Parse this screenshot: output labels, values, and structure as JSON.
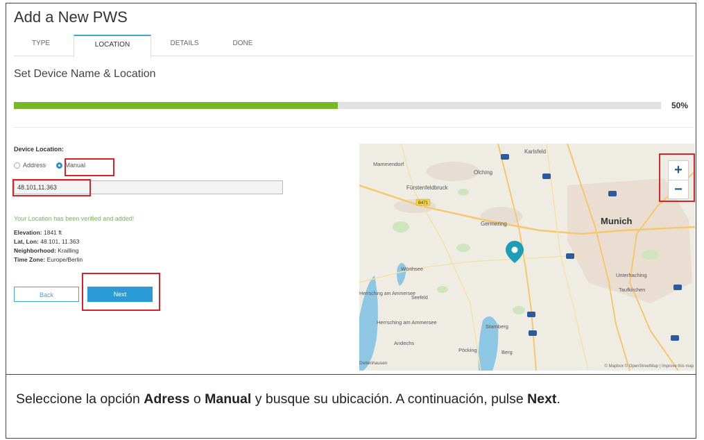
{
  "page": {
    "title": "Add a New PWS",
    "subtitle": "Set Device Name & Location"
  },
  "tabs": [
    {
      "label": "TYPE",
      "active": false
    },
    {
      "label": "LOCATION",
      "active": true
    },
    {
      "label": "DETAILS",
      "active": false
    },
    {
      "label": "DONE",
      "active": false
    }
  ],
  "progress": {
    "value": 0.5,
    "label": "50%"
  },
  "location": {
    "label": "Device Location:",
    "options": {
      "address": "Address",
      "manual": "Manual"
    },
    "selected": "Manual",
    "coordinates_value": "48.101,11.363",
    "verified_message": "Your Location has been verified and added!",
    "elevation": {
      "label": "Elevation:",
      "value": "1841 ft"
    },
    "latlon": {
      "label": "Lat, Lon:",
      "value": "48.101, 11.363"
    },
    "neighborhood": {
      "label": "Neighborhood:",
      "value": "Krailling"
    },
    "timezone": {
      "label": "Time Zone:",
      "value": "Europe/Berlin"
    }
  },
  "buttons": {
    "back": "Back",
    "next": "Next"
  },
  "map": {
    "places": {
      "karlsfeld": "Karlsfeld",
      "mammendorf": "Mammendorf",
      "olching": "Olching",
      "fuerstenfeldbruck": "Fürstenfeldbruck",
      "germering": "Germering",
      "munich": "Munich",
      "woerthsee": "Wörthsee",
      "unterhaching": "Unterhaching",
      "taufkirchen": "Taufkirchen",
      "herrsching1": "Herrsching am Ammersee",
      "seefeld": "Seefeld",
      "herrsching2": "Herrsching am Ammersee",
      "starnberg": "Starnberg",
      "andechs": "Andechs",
      "pocking": "Pöcking",
      "berg": "Berg",
      "dettenhausen": "Dettenhausen"
    },
    "road_badge": "B471",
    "zoom_in": "+",
    "zoom_out": "−",
    "attribution": "© Mapbox © OpenStreetMap | Improve this map"
  },
  "caption": {
    "part1": "Seleccione la opción ",
    "bold1": "Adress",
    "part2": " o ",
    "bold2": "Manual",
    "part3": " y busque su ubicación. A continuación, pulse ",
    "bold3": "Next",
    "part4": "."
  },
  "colors": {
    "accent": "#3fa7d6",
    "progress": "#77b82a",
    "highlight": "#d6232c",
    "verified": "#6cbb4a",
    "map_pin": "#1c9fb6"
  }
}
